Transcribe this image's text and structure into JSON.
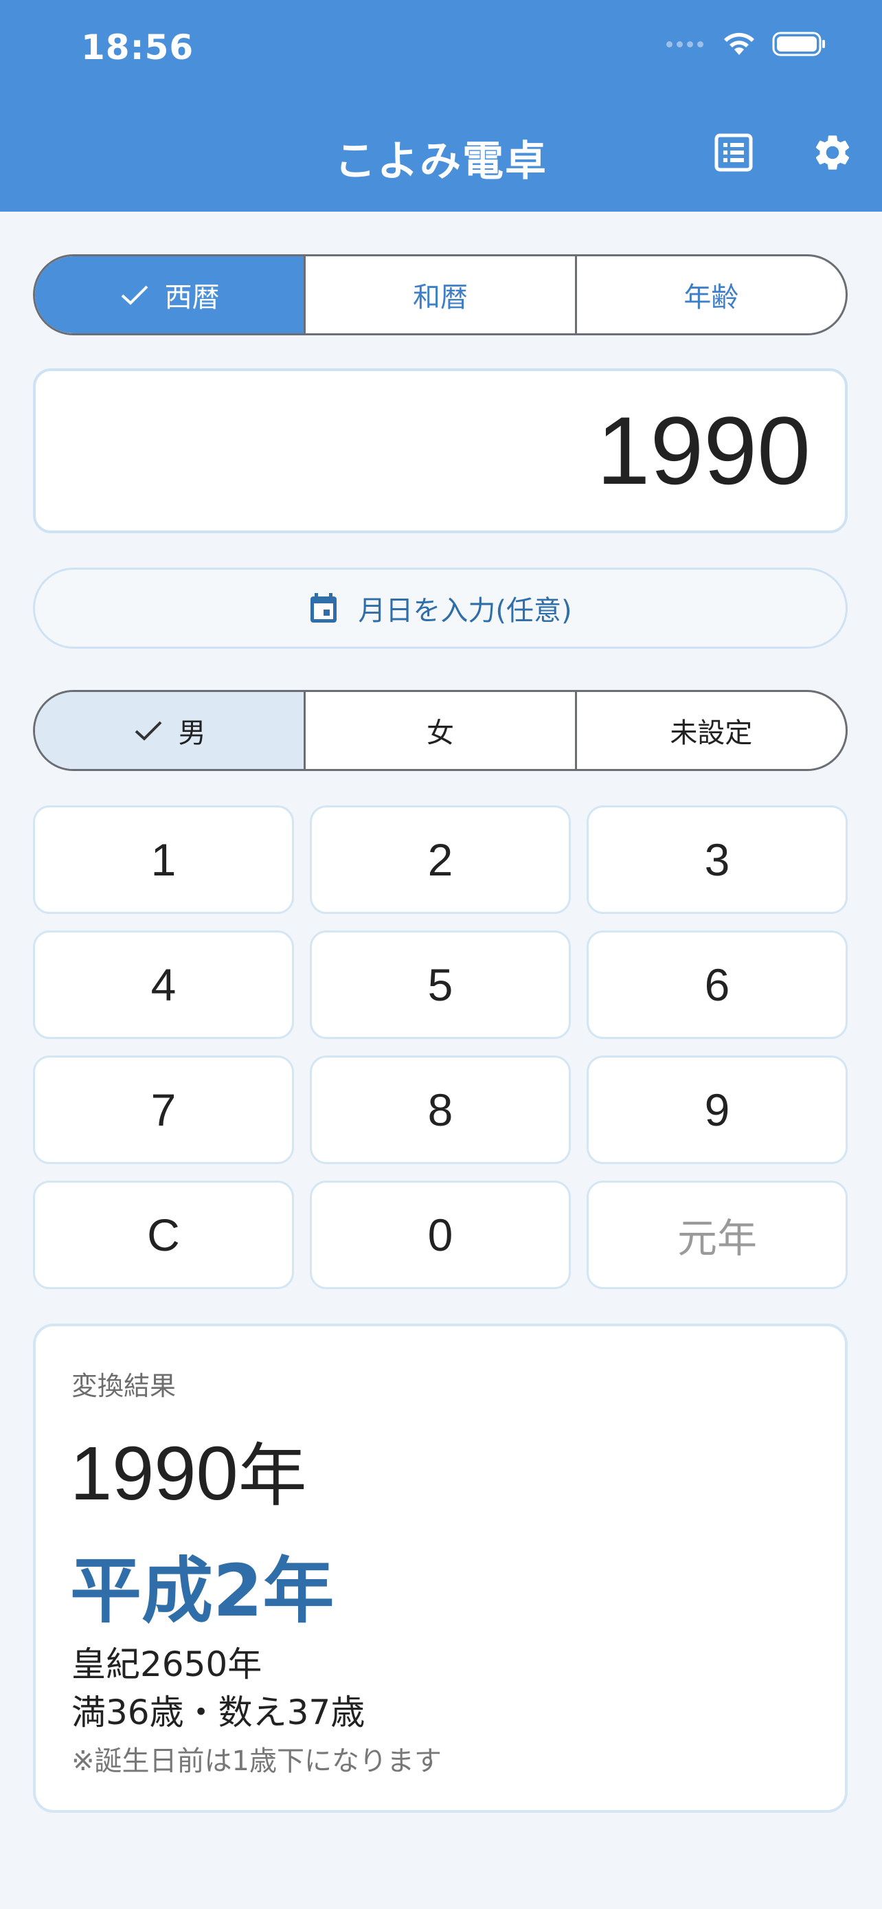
{
  "status_bar": {
    "time": "18:56"
  },
  "app_bar": {
    "title": "こよみ電卓",
    "list_icon": "list-icon",
    "settings_icon": "gear-icon"
  },
  "mode_tabs": [
    {
      "label": "西暦",
      "selected": true
    },
    {
      "label": "和暦",
      "selected": false
    },
    {
      "label": "年齢",
      "selected": false
    }
  ],
  "display": {
    "value": "1990"
  },
  "date_button": {
    "label": "月日を入力(任意)",
    "icon": "calendar-icon"
  },
  "gender_tabs": [
    {
      "label": "男",
      "selected": true
    },
    {
      "label": "女",
      "selected": false
    },
    {
      "label": "未設定",
      "selected": false
    }
  ],
  "keypad": [
    "1",
    "2",
    "3",
    "4",
    "5",
    "6",
    "7",
    "8",
    "9",
    "C",
    "0",
    "元年"
  ],
  "result": {
    "label": "変換結果",
    "western_year": "1990",
    "western_suffix": "年",
    "japanese_year": "平成2年",
    "koki": "皇紀2650年",
    "age": "満36歳・数え37歳",
    "note": "※誕生日前は1歳下になります"
  },
  "colors": {
    "primary": "#4a8fd9",
    "accent_text": "#2f6ea8",
    "background": "#f2f6fa"
  }
}
